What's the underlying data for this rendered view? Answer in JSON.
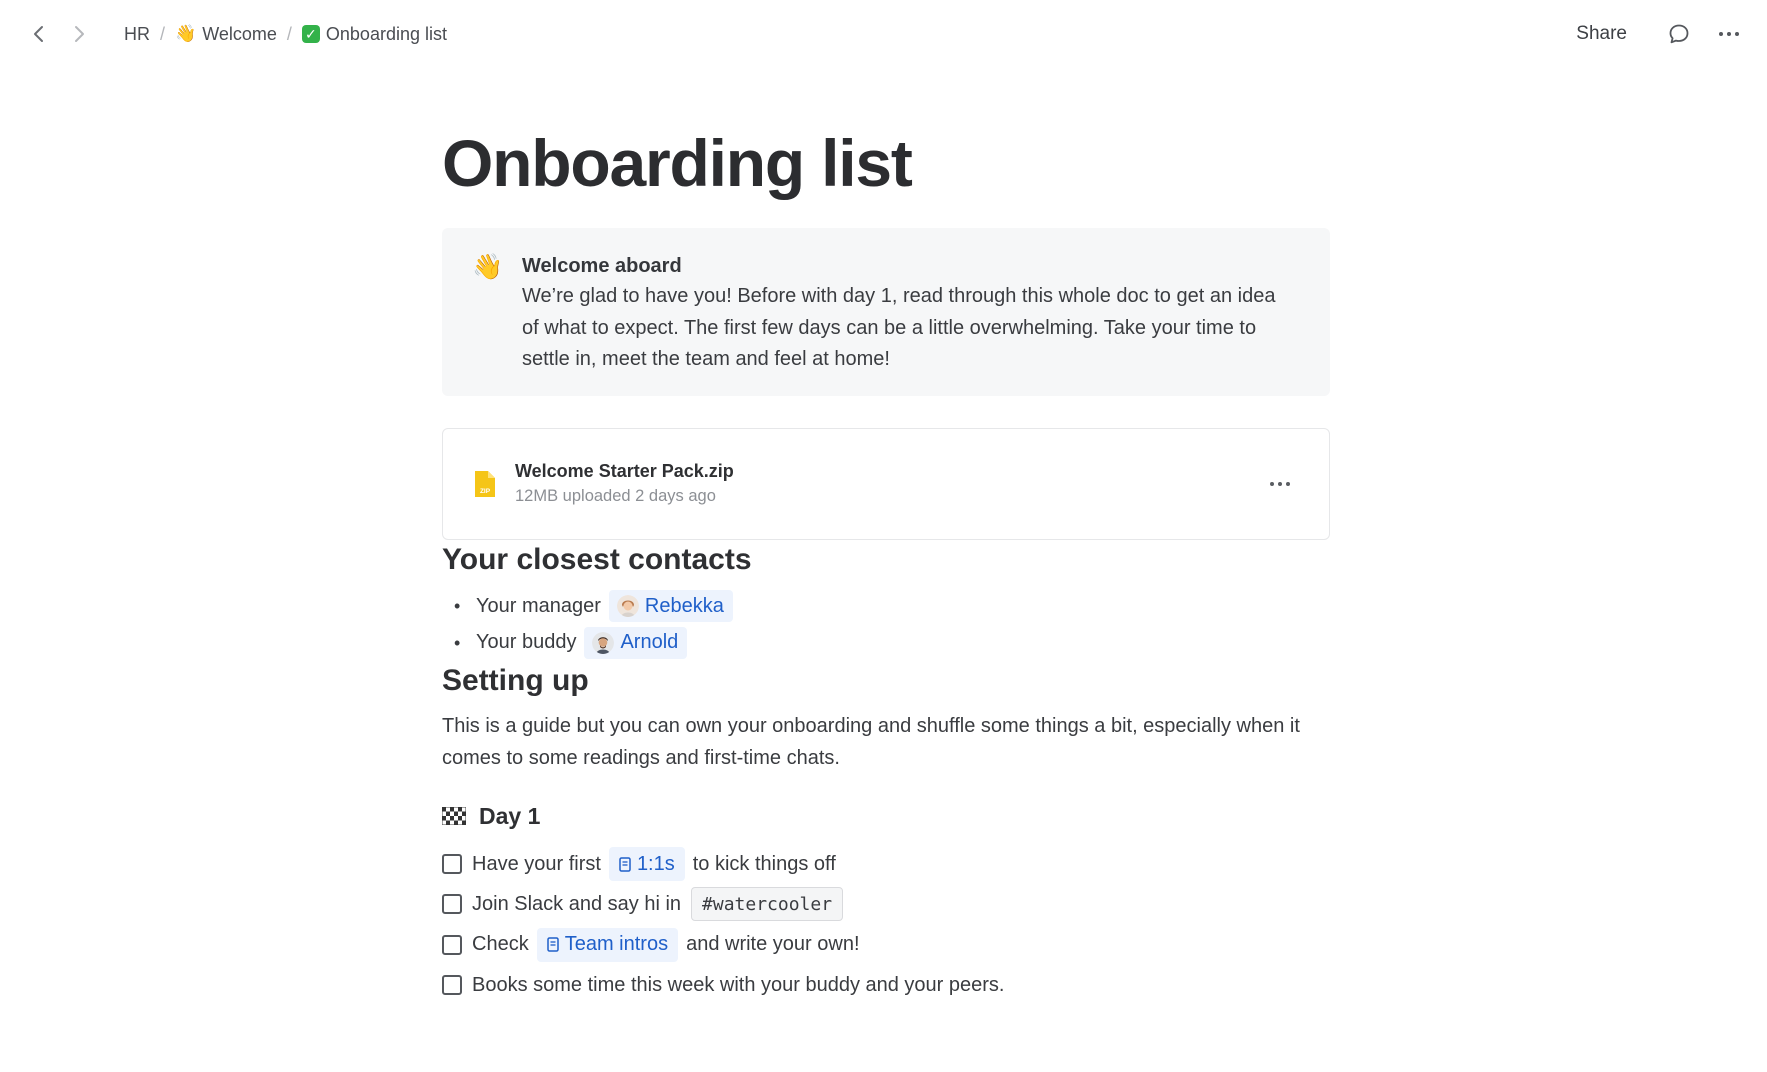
{
  "topbar": {
    "breadcrumbs": [
      {
        "emoji": "",
        "label": "HR"
      },
      {
        "emoji": "👋",
        "label": "Welcome"
      },
      {
        "emoji": "✓",
        "label": "Onboarding list"
      }
    ],
    "separator": "/",
    "share_label": "Share",
    "icons": [
      "back-icon",
      "forward-icon",
      "comment-icon",
      "more-icon"
    ]
  },
  "page": {
    "title": "Onboarding list"
  },
  "callout": {
    "emoji": "👋",
    "title": "Welcome aboard",
    "text": "We’re glad to have you! Before with day 1, read through this whole doc to get an idea of what to expect. The first few days can be a little overwhelming. Take your time to settle in, meet the team and feel at home!"
  },
  "file": {
    "name": "Welcome Starter Pack.zip",
    "meta": "12MB uploaded 2 days ago",
    "icon_label": "ZIP"
  },
  "contacts": {
    "heading": "Your closest contacts",
    "items": [
      {
        "label": "Your manager",
        "person": "Rebekka"
      },
      {
        "label": "Your buddy",
        "person": "Arnold"
      }
    ]
  },
  "setup": {
    "heading": "Setting up",
    "intro": "This is a guide but you can own your onboarding and shuffle some things a bit, especially when it comes to some readings and first-time chats.",
    "day_heading": "Day 1",
    "tasks": [
      {
        "before": "Have your first",
        "link": "1:1s",
        "after": "to kick things off"
      },
      {
        "before": "Join Slack and say hi in",
        "code": "#watercooler"
      },
      {
        "before": "Check",
        "link": "Team intros",
        "after": "and write your own!"
      },
      {
        "before": "Books some time this week with your buddy and your peers."
      }
    ]
  },
  "colors": {
    "accent": "#1f5fc9",
    "mention_bg": "#edf3fd",
    "callout_bg": "#f6f7f8",
    "zip_yellow": "#f5c517"
  }
}
